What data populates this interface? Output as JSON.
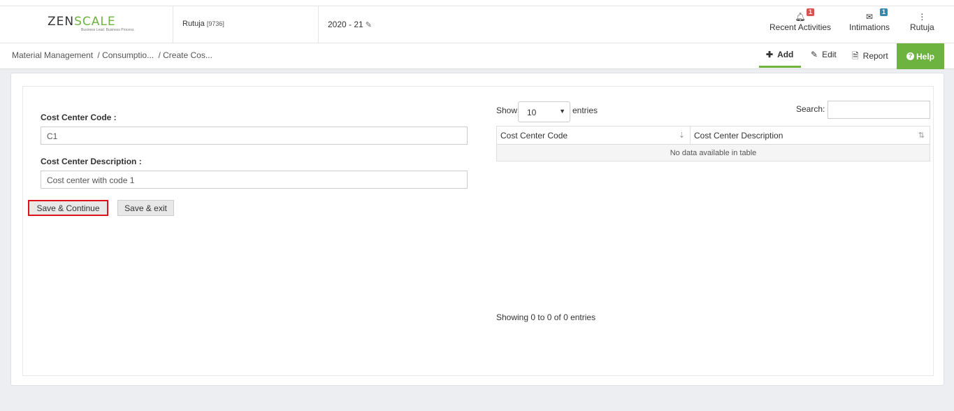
{
  "header": {
    "logo": {
      "brand_main": "ZEN",
      "brand_accent": "SCALE",
      "tagline": "Business Lead. Business Process."
    },
    "user_name": "Rutuja",
    "user_id": "[9736]",
    "fiscal_year": "2020 - 21",
    "recent_activities": {
      "label": "Recent Activities",
      "badge": "1"
    },
    "intimations": {
      "label": "Intimations",
      "badge": "1"
    },
    "profile": {
      "label": "Rutuja"
    }
  },
  "breadcrumb": [
    "Material Management",
    "/ Consumptio...",
    "/ Create Cos..."
  ],
  "toolbar": {
    "add_label": "Add",
    "edit_label": "Edit",
    "report_label": "Report",
    "help_label": "Help"
  },
  "form": {
    "code_label": "Cost Center Code :",
    "code_value": "C1",
    "desc_label": "Cost Center Description :",
    "desc_value": "Cost center with code 1",
    "save_continue_label": "Save & Continue",
    "save_exit_label": "Save & exit"
  },
  "table": {
    "show_label": "Show",
    "page_size": "10",
    "entries_label": "entries",
    "search_label": "Search:",
    "columns": [
      "Cost Center Code",
      "Cost Center Description"
    ],
    "empty_message": "No data available in table",
    "info": "Showing 0 to 0 of 0 entries"
  },
  "colors": {
    "accent": "#6cb33f",
    "highlight_border": "#e0101a"
  }
}
